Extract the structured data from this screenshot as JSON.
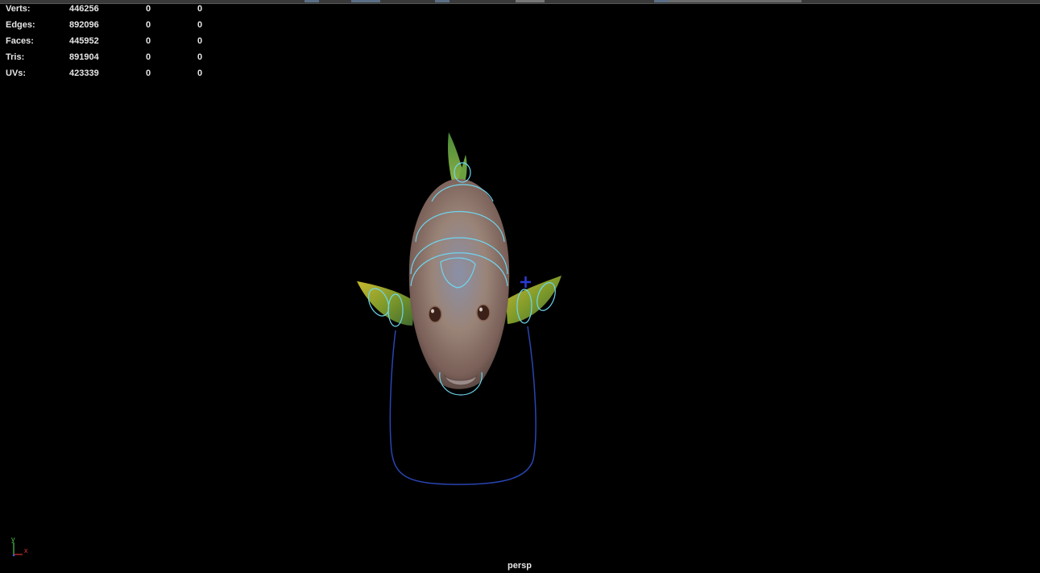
{
  "hud": {
    "rows": [
      {
        "label": "Verts:",
        "v1": "446256",
        "v2": "0",
        "v3": "0"
      },
      {
        "label": "Edges:",
        "v1": "892096",
        "v2": "0",
        "v3": "0"
      },
      {
        "label": "Faces:",
        "v1": "445952",
        "v2": "0",
        "v3": "0"
      },
      {
        "label": "Tris:",
        "v1": "891904",
        "v2": "0",
        "v3": "0"
      },
      {
        "label": "UVs:",
        "v1": "423339",
        "v2": "0",
        "v3": "0"
      }
    ]
  },
  "viewport": {
    "camera_name": "persp",
    "background_color": "#000000",
    "controls_color": "#6fd6f0",
    "root_control_color": "#2a44b0"
  },
  "axis": {
    "y_label": "y",
    "x_label": "x"
  }
}
